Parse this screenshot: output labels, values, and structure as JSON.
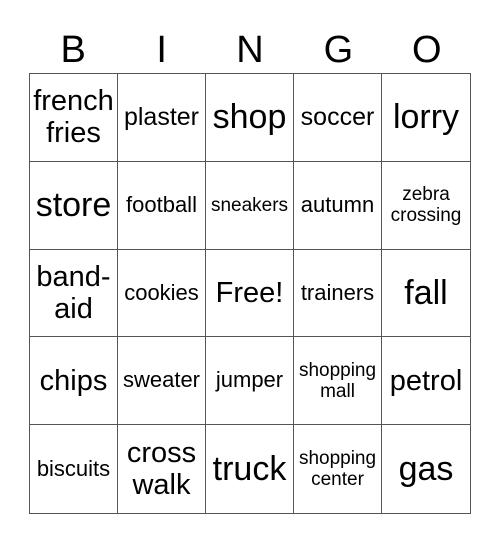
{
  "header": [
    "B",
    "I",
    "N",
    "G",
    "O"
  ],
  "cells": [
    {
      "text": "french fries",
      "size": "l"
    },
    {
      "text": "plaster",
      "size": "m"
    },
    {
      "text": "shop",
      "size": "xl"
    },
    {
      "text": "soccer",
      "size": "m"
    },
    {
      "text": "lorry",
      "size": "xl"
    },
    {
      "text": "store",
      "size": "xl"
    },
    {
      "text": "football",
      "size": "s"
    },
    {
      "text": "sneakers",
      "size": "xs"
    },
    {
      "text": "autumn",
      "size": "s"
    },
    {
      "text": "zebra crossing",
      "size": "xs"
    },
    {
      "text": "band-aid",
      "size": "l"
    },
    {
      "text": "cookies",
      "size": "s"
    },
    {
      "text": "Free!",
      "size": "l"
    },
    {
      "text": "trainers",
      "size": "s"
    },
    {
      "text": "fall",
      "size": "xl"
    },
    {
      "text": "chips",
      "size": "l"
    },
    {
      "text": "sweater",
      "size": "s"
    },
    {
      "text": "jumper",
      "size": "s"
    },
    {
      "text": "shopping mall",
      "size": "xs"
    },
    {
      "text": "petrol",
      "size": "l"
    },
    {
      "text": "biscuits",
      "size": "s"
    },
    {
      "text": "cross walk",
      "size": "l"
    },
    {
      "text": "truck",
      "size": "xl"
    },
    {
      "text": "shopping center",
      "size": "xs"
    },
    {
      "text": "gas",
      "size": "xl"
    }
  ]
}
